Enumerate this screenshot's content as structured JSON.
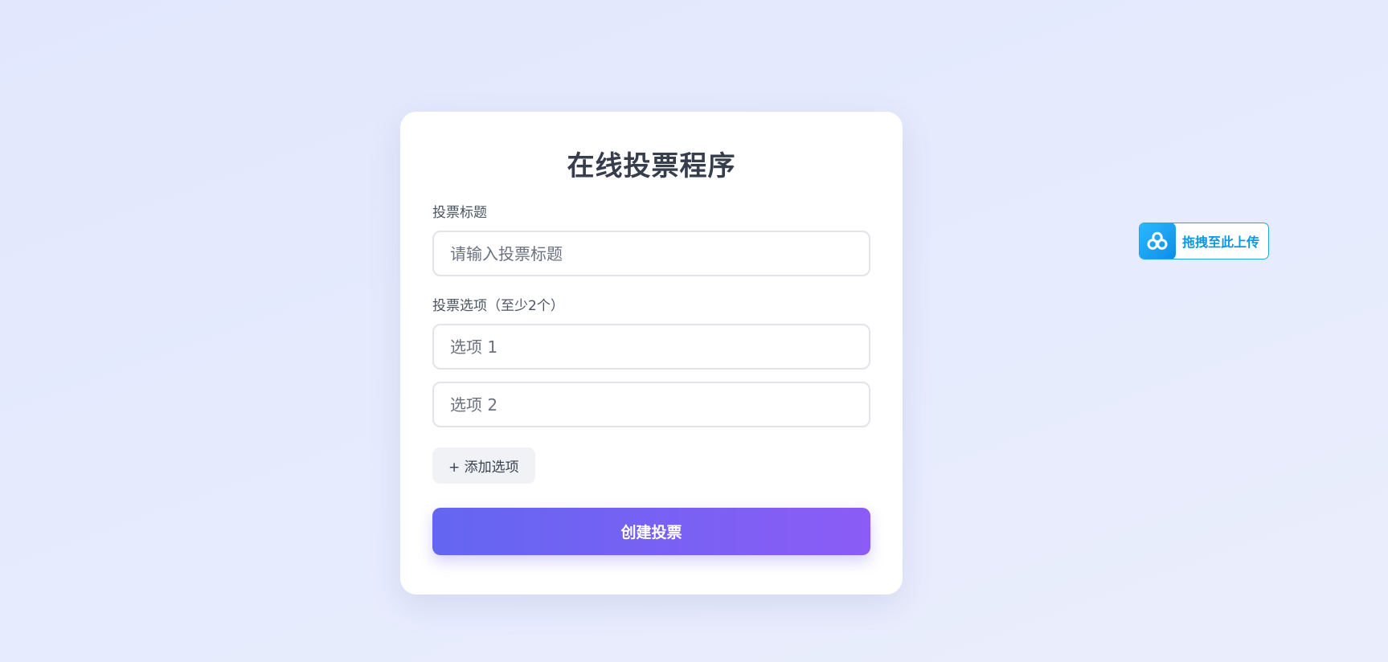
{
  "form": {
    "heading": "在线投票程序",
    "title_label": "投票标题",
    "title_input": {
      "placeholder": "请输入投票标题",
      "value": ""
    },
    "options_label": "投票选项（至少2个）",
    "options": [
      {
        "placeholder": "选项 1",
        "value": ""
      },
      {
        "placeholder": "选项 2",
        "value": ""
      }
    ],
    "add_option_label": "+ 添加选项",
    "submit_label": "创建投票"
  },
  "upload_widget": {
    "icon": "cloud-upload-icon",
    "label": "拖拽至此上传"
  },
  "colors": {
    "background": "#e4e9fd",
    "card": "#ffffff",
    "heading": "#363d4c",
    "accent_start": "#6366f1",
    "accent_end": "#8b5cf6",
    "upload_accent": "#1aa6ee"
  }
}
